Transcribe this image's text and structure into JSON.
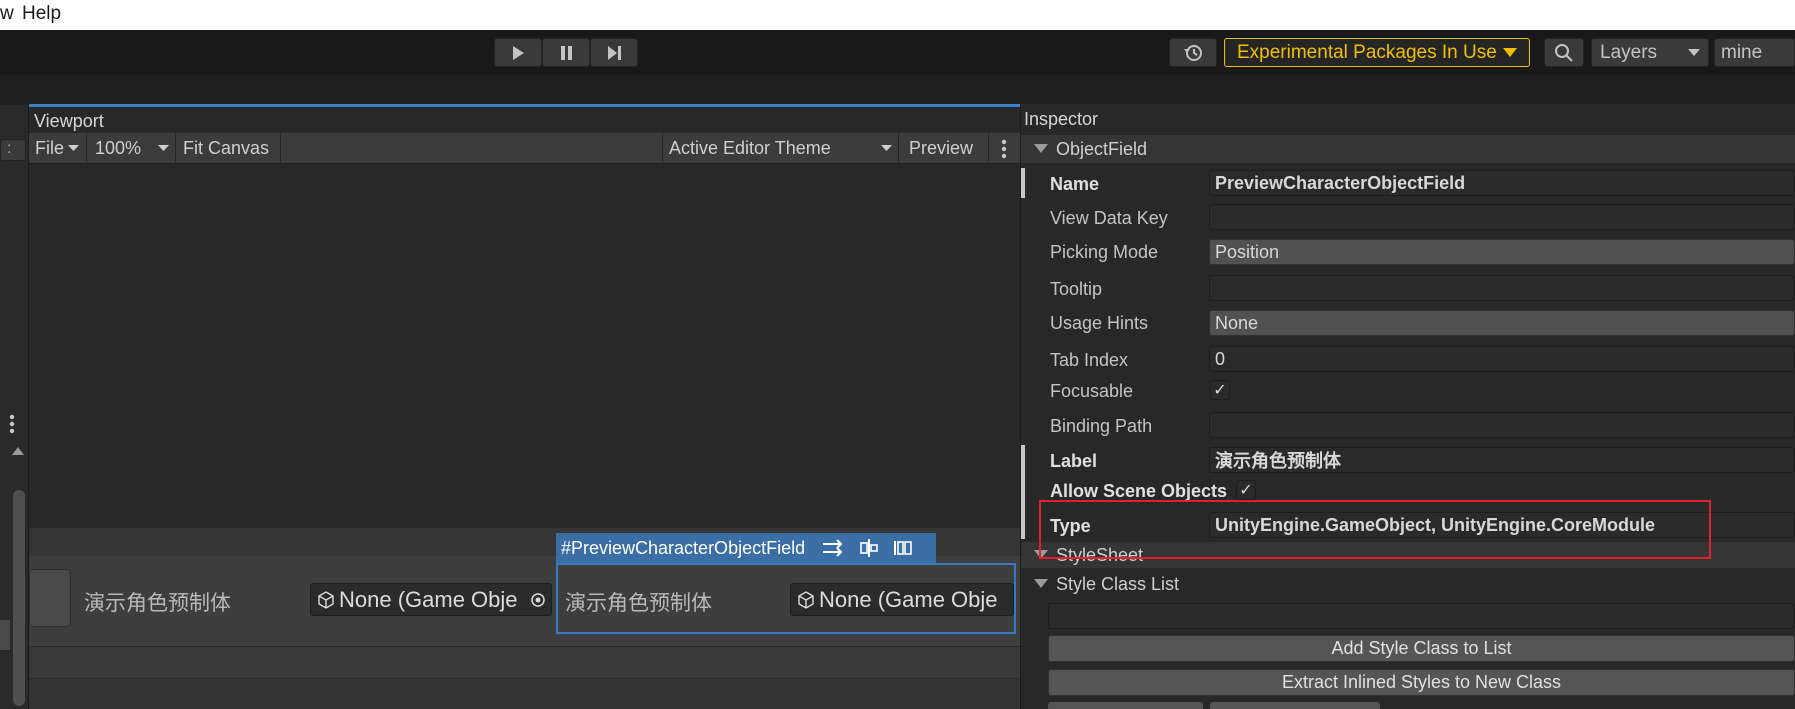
{
  "menubar": {
    "item_view_fragment": "w",
    "item_help": "Help"
  },
  "toolbar": {
    "experimental_label": "Experimental Packages In Use",
    "layers_label": "Layers",
    "layout_label": "mine"
  },
  "viewport": {
    "title": "Viewport",
    "file_menu": "File",
    "zoom": "100%",
    "fit_canvas": "Fit Canvas",
    "theme": "Active Editor Theme",
    "preview": "Preview",
    "selected_tag": "#PreviewCharacterObjectField",
    "label_1": "演示角色预制体",
    "field_1": "None (Game Obje",
    "label_2": "演示角色预制体",
    "field_2": "None (Game Obje",
    "left_fragment": ":"
  },
  "inspector": {
    "title": "Inspector",
    "section_objectfield": "ObjectField",
    "properties": [
      {
        "label": "Name",
        "value": "PreviewCharacterObjectField"
      },
      {
        "label": "View Data Key",
        "value": ""
      },
      {
        "label": "Picking Mode",
        "value": "Position"
      },
      {
        "label": "Tooltip",
        "value": ""
      },
      {
        "label": "Usage Hints",
        "value": "None"
      },
      {
        "label": "Tab Index",
        "value": "0"
      },
      {
        "label": "Focusable",
        "value": "✓"
      },
      {
        "label": "Binding Path",
        "value": ""
      },
      {
        "label": "Label",
        "value": "演示角色预制体"
      },
      {
        "label": "Allow Scene Objects",
        "value": "✓"
      },
      {
        "label": "Type",
        "value": "UnityEngine.GameObject, UnityEngine.CoreModule"
      }
    ],
    "section_stylesheet": "StyleSheet",
    "section_styleclasslist": "Style Class List",
    "add_style_class": "Add Style Class to List",
    "extract_styles": "Extract Inlined Styles to New Class"
  },
  "colors": {
    "accent_blue": "#3b82c8",
    "selection_blue": "#3a6ea5",
    "warning_yellow": "#f0c000",
    "highlight_red": "#e0202a"
  }
}
